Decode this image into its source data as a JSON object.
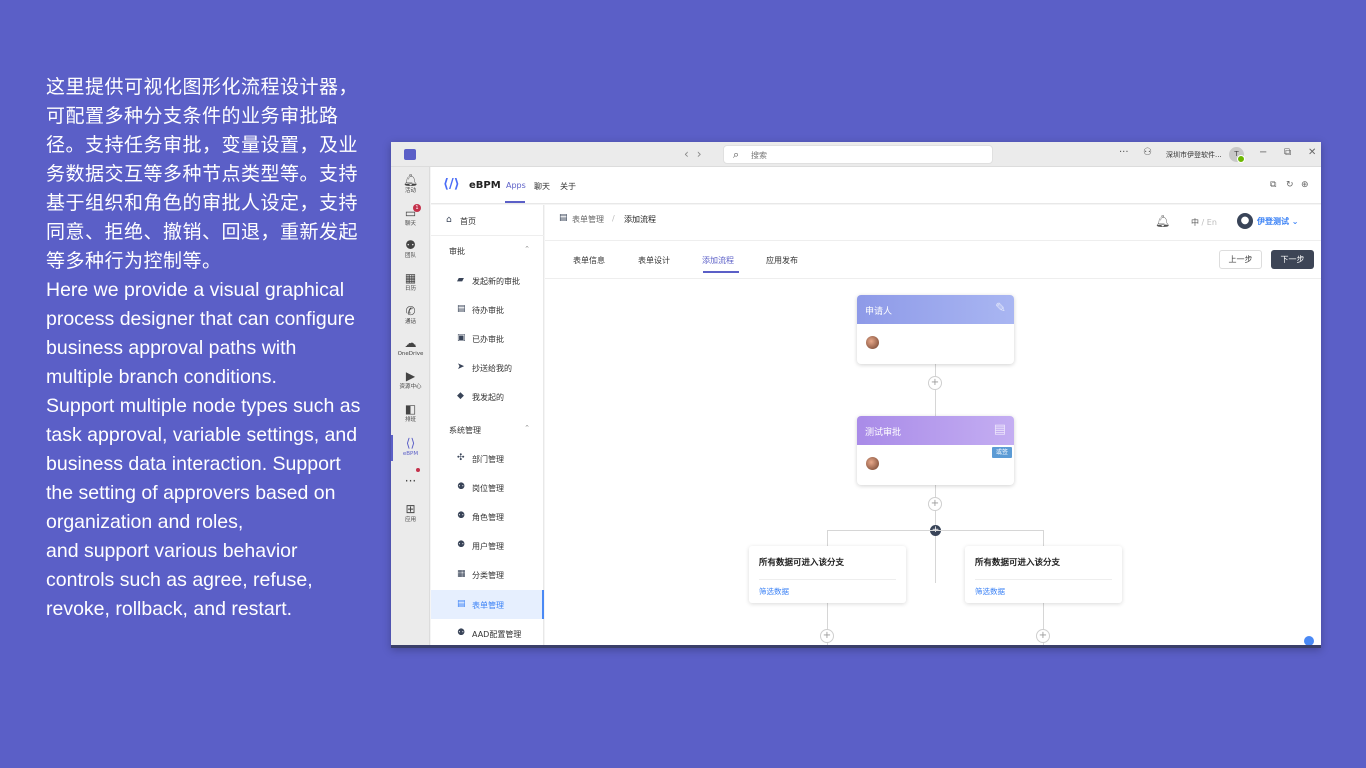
{
  "intro": {
    "zh": "这里提供可视化图形化流程设计器，可配置多种分支条件的业务审批路径。支持任务审批，变量设置，及业务数据交互等多种节点类型等。支持基于组织和角色的审批人设定，支持同意、拒绝、撤销、回退，重新发起等多种行为控制等。",
    "en1": "Here we provide a visual graphical process designer that can configure business approval paths with multiple branch conditions.",
    "en2": "Support multiple node types such as task approval, variable settings, and business data interaction. Support the setting of approvers based on organization and roles,",
    "en3": "and support various behavior controls such as agree, refuse, revoke, rollback, and restart."
  },
  "titlebar": {
    "search_placeholder": "搜索",
    "org": "深圳市伊登软件...",
    "avatar": "T",
    "more": "···"
  },
  "rail": [
    {
      "label": "活动",
      "icon": "bell-icon"
    },
    {
      "label": "聊天",
      "icon": "chat-icon",
      "badge": "1"
    },
    {
      "label": "团队",
      "icon": "teams-icon"
    },
    {
      "label": "日历",
      "icon": "calendar-icon"
    },
    {
      "label": "通话",
      "icon": "phone-icon"
    },
    {
      "label": "OneDrive",
      "icon": "cloud-icon"
    },
    {
      "label": "资源中心",
      "icon": "video-icon"
    },
    {
      "label": "排班",
      "icon": "shifts-icon"
    },
    {
      "label": "eBPM",
      "icon": "ebpm-icon"
    },
    {
      "label": "···",
      "icon": "more-icon"
    },
    {
      "label": "应用",
      "icon": "apps-icon"
    }
  ],
  "appbar": {
    "name": "eBPM",
    "tabs": [
      "Apps",
      "聊天",
      "关于"
    ]
  },
  "sidebar": {
    "home": "首页",
    "group1": "审批",
    "group1_items": [
      "发起新的审批",
      "待办审批",
      "已办审批",
      "抄送给我的",
      "我发起的"
    ],
    "group2": "系统管理",
    "group2_items": [
      "部门管理",
      "岗位管理",
      "角色管理",
      "用户管理",
      "分类管理",
      "表单管理",
      "AAD配置管理"
    ]
  },
  "header": {
    "breadcrumb": [
      "表单管理",
      "添加流程"
    ],
    "breadcrumb_sep": "/",
    "lang_zh": "中",
    "lang_sep": "/",
    "lang_en": "En",
    "user": "伊登测试"
  },
  "steps": {
    "tabs": [
      "表单信息",
      "表单设计",
      "添加流程",
      "应用发布"
    ],
    "active": "添加流程",
    "prev": "上一步",
    "next": "下一步"
  },
  "flow": {
    "applicant": "申请人",
    "approval": "测试审批",
    "approval_tag": "或签",
    "branches": [
      {
        "title": "所有数据可进入该分支",
        "link": "筛选数据"
      },
      {
        "title": "所有数据可进入该分支",
        "link": "筛选数据"
      }
    ],
    "plus": "+"
  },
  "colors": {
    "background": "#5b5fc7",
    "accent": "#5b5fc7",
    "link": "#3b82f6",
    "primary_button": "#3d4556"
  }
}
